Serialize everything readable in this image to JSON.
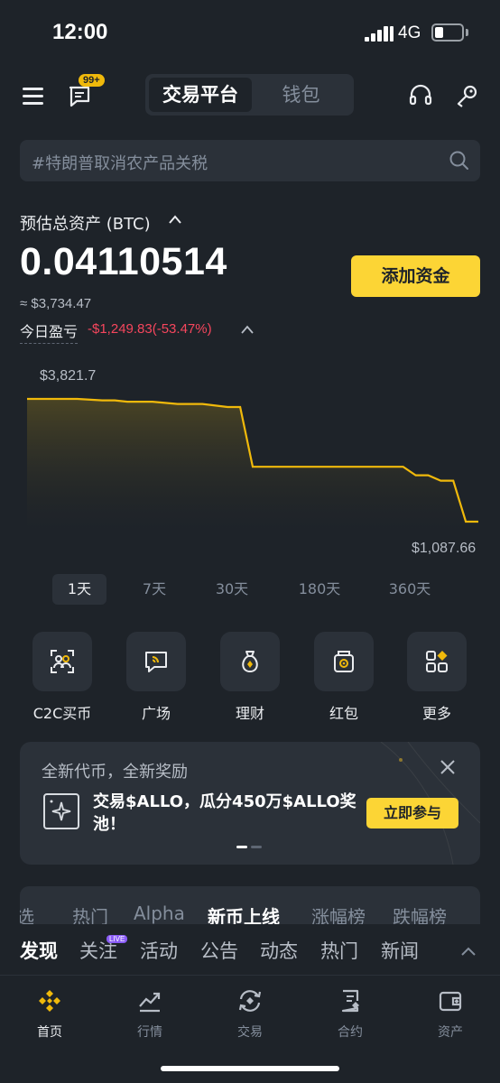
{
  "status_bar": {
    "time": "12:00",
    "network": "4G"
  },
  "header": {
    "badge": "99+",
    "tabs": [
      {
        "label": "交易平台",
        "active": true
      },
      {
        "label": "钱包",
        "active": false
      }
    ]
  },
  "search": {
    "placeholder": "#特朗普取消农产品关税"
  },
  "assets": {
    "label": "预估总资产 (BTC)",
    "value": "0.04110514",
    "usd": "≈ $3,734.47",
    "pnl_label": "今日盈亏",
    "pnl_value": "-$1,249.83(-53.47%)",
    "add_funds": "添加资金"
  },
  "chart": {
    "max_label": "$3,821.7",
    "min_label": "$1,087.66",
    "periods": [
      "1天",
      "7天",
      "30天",
      "180天",
      "360天"
    ],
    "active_period": "1天"
  },
  "chart_data": {
    "type": "area",
    "x": [
      0,
      2,
      4,
      6,
      7,
      8,
      10,
      12,
      13,
      14,
      16,
      17,
      18,
      20,
      22,
      24,
      26,
      28,
      30,
      31,
      32,
      33,
      34,
      35,
      36
    ],
    "values": [
      3821.7,
      3821.7,
      3821.7,
      3790,
      3790,
      3760,
      3760,
      3710,
      3710,
      3710,
      3640,
      3640,
      2310,
      2310,
      2310,
      2310,
      2310,
      2310,
      2310,
      2120,
      2120,
      2000,
      2000,
      1087.66,
      1087.66
    ],
    "ylim": [
      1087.66,
      3821.7
    ],
    "line_color": "#f0b90b"
  },
  "quick_actions": [
    {
      "label": "C2C买币",
      "icon": "c2c-icon"
    },
    {
      "label": "广场",
      "icon": "square-icon"
    },
    {
      "label": "理财",
      "icon": "earn-icon"
    },
    {
      "label": "红包",
      "icon": "red-packet-icon"
    },
    {
      "label": "更多",
      "icon": "more-icon"
    }
  ],
  "promo": {
    "title": "全新代币，全新奖励",
    "text": "交易$ALLO，瓜分450万$ALLO奖池！",
    "button": "立即参与"
  },
  "market_tabs": [
    {
      "label": "选",
      "active": false
    },
    {
      "label": "热门",
      "active": false
    },
    {
      "label": "Alpha",
      "active": false
    },
    {
      "label": "新币上线",
      "active": true
    },
    {
      "label": "涨幅榜",
      "active": false
    },
    {
      "label": "跌幅榜",
      "active": false
    }
  ],
  "discover_tabs": [
    {
      "label": "发现",
      "active": true
    },
    {
      "label": "关注",
      "active": false
    },
    {
      "label": "活动",
      "active": false
    },
    {
      "label": "公告",
      "active": false
    },
    {
      "label": "动态",
      "active": false
    },
    {
      "label": "热门",
      "active": false
    },
    {
      "label": "新闻",
      "active": false
    }
  ],
  "live_badge": "LIVE",
  "bottom_nav": [
    {
      "label": "首页",
      "icon": "home-icon",
      "active": true
    },
    {
      "label": "行情",
      "icon": "markets-icon",
      "active": false
    },
    {
      "label": "交易",
      "icon": "trade-icon",
      "active": false
    },
    {
      "label": "合约",
      "icon": "futures-icon",
      "active": false
    },
    {
      "label": "资产",
      "icon": "wallet-icon",
      "active": false
    }
  ],
  "colors": {
    "accent": "#fcd535",
    "negative": "#f6465d",
    "background": "#1e2329",
    "card": "#2b3139"
  }
}
